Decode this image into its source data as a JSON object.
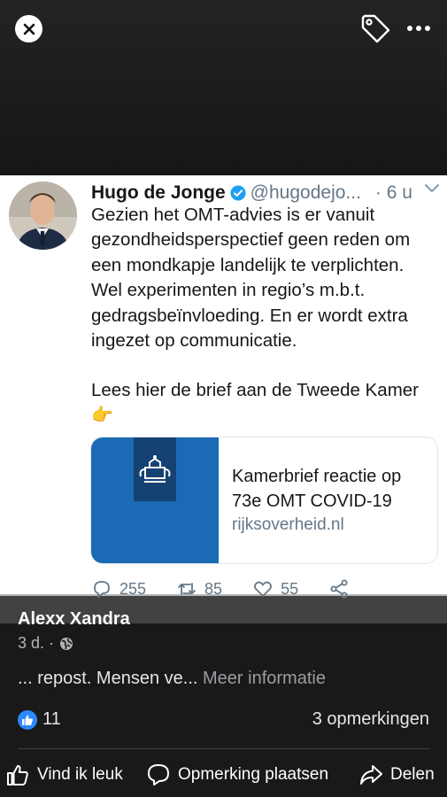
{
  "viewer": {
    "close_icon": "close-icon",
    "tag_icon": "tag-icon",
    "more_icon": "more-icon"
  },
  "tweet": {
    "name": "Hugo de Jonge",
    "handle": "@hugodejo...",
    "time": "· 6 u",
    "lines": [
      "Gezien het OMT-advies is er vanuit",
      "gezondheidsperspectief geen reden om",
      "een mondkapje landelijk te verplichten.",
      "Wel experimenten in regio’s m.b.t.",
      "gedragsbeïnvloeding. En er wordt extra",
      "ingezet op communicatie."
    ],
    "link_line": "Lees hier de brief aan de Tweede Kamer",
    "pointing_emoji": "👉",
    "card": {
      "title": "Kamerbrief reactie op 73e OMT COVID-19",
      "domain": "rijksoverheid.nl"
    },
    "actions": {
      "replies": "255",
      "retweets": "85",
      "likes": "55"
    }
  },
  "post": {
    "author": "Alexx Xandra",
    "time": "3 d. ·",
    "caption": "... repost. Mensen ve...",
    "more_label": "Meer informatie",
    "like_count": "11",
    "comments": "3 opmerkingen"
  },
  "actions": {
    "like": "Vind ik leuk",
    "comment": "Opmerking plaatsen",
    "share": "Delen"
  },
  "colors": {
    "accent": "#2d88ff",
    "twitter_blue": "#1da1f2",
    "rijks_blue": "#1b6ab5"
  }
}
